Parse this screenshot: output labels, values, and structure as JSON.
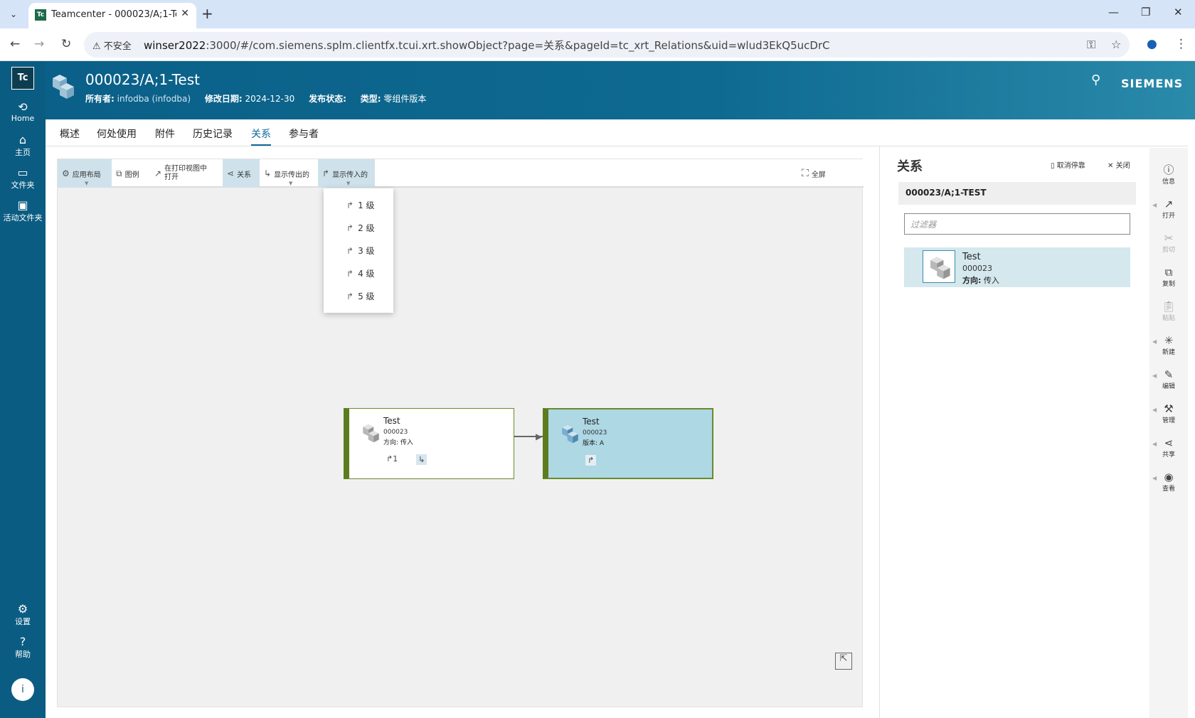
{
  "browser": {
    "tab_title": "Teamcenter - 000023/A;1-Test",
    "tab_favicon": "Tc",
    "security_label": "不安全",
    "url_host": "winser2022",
    "url_rest": ":3000/#/com.siemens.splm.clientfx.tcui.xrt.showObject?page=关系&pageId=tc_xrt_Relations&uid=wlud3EkQ5ucDrC"
  },
  "leftnav": {
    "logo": "Tc",
    "items": [
      {
        "icon": "home-icon",
        "label": "Home"
      },
      {
        "icon": "house-icon",
        "label": "主页"
      },
      {
        "icon": "folder-icon",
        "label": "文件夹"
      },
      {
        "icon": "active-folder-icon",
        "label": "活动文件夹"
      }
    ],
    "bottom": [
      {
        "icon": "gear-icon",
        "label": "设置"
      },
      {
        "icon": "help-icon",
        "label": "帮助"
      }
    ],
    "info": "i"
  },
  "header": {
    "title": "000023/A;1-Test",
    "owner_label": "所有者:",
    "owner_value": "infodba (infodba)",
    "modified_label": "修改日期:",
    "modified_value": "2024-12-30",
    "release_label": "发布状态:",
    "type_label": "类型:",
    "type_value": "零组件版本",
    "brand": "SIEMENS"
  },
  "page_tabs": [
    "概述",
    "何处使用",
    "附件",
    "历史记录",
    "关系",
    "参与者"
  ],
  "active_tab": "关系",
  "toolbar": {
    "apply_layout": "应用布局",
    "legend": "图例",
    "open_print_1": "在打印视图中",
    "open_print_2": "打开",
    "relations": "关系",
    "show_outgoing": "显示传出的",
    "show_incoming": "显示传入的",
    "fullscreen": "全屏"
  },
  "dropdown": [
    "1 级",
    "2 级",
    "3 级",
    "4 级",
    "5 级"
  ],
  "nodes": {
    "a": {
      "name": "Test",
      "id": "000023",
      "prop": "方向: 传入",
      "badge": "1"
    },
    "b": {
      "name": "Test",
      "id": "000023",
      "prop": "版本: A"
    }
  },
  "panel": {
    "title": "关系",
    "unpin": "取消停靠",
    "close": "关闭",
    "breadcrumb": "000023/A;1-TEST",
    "filter_placeholder": "过滤器",
    "item": {
      "name": "Test",
      "id": "000023",
      "dir_label": "方向:",
      "dir_value": "传入"
    }
  },
  "right_tools": [
    {
      "icon": "info-icon",
      "label": "信息",
      "enabled": true
    },
    {
      "icon": "open-icon",
      "label": "打开",
      "enabled": true
    },
    {
      "icon": "cut-icon",
      "label": "剪切",
      "enabled": false
    },
    {
      "icon": "copy-icon",
      "label": "复制",
      "enabled": true
    },
    {
      "icon": "paste-icon",
      "label": "粘贴",
      "enabled": false
    },
    {
      "icon": "new-icon",
      "label": "新建",
      "enabled": true
    },
    {
      "icon": "edit-icon",
      "label": "编辑",
      "enabled": true
    },
    {
      "icon": "manage-icon",
      "label": "管理",
      "enabled": true
    },
    {
      "icon": "share-icon",
      "label": "共享",
      "enabled": true
    },
    {
      "icon": "view-icon",
      "label": "查看",
      "enabled": true
    }
  ]
}
